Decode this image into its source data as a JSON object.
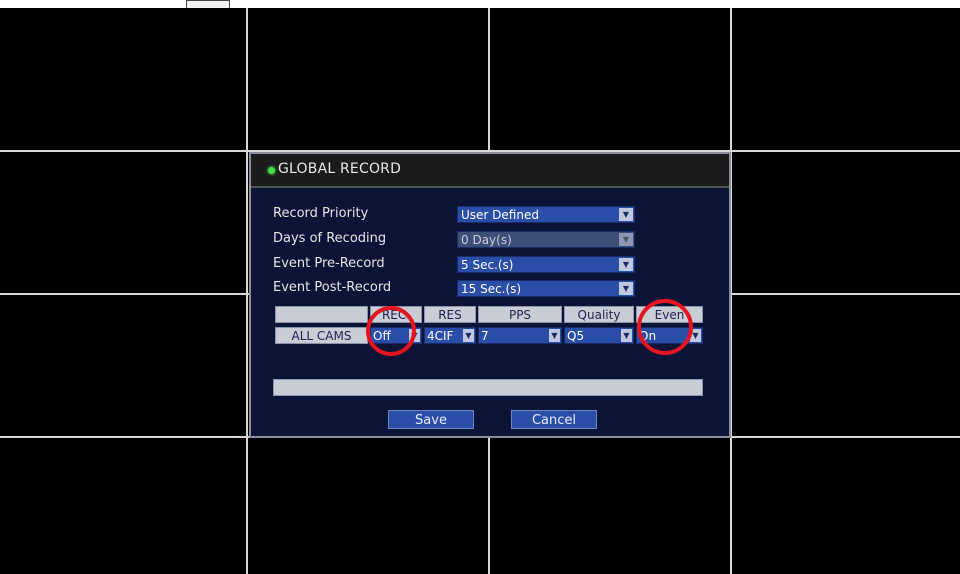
{
  "dialog": {
    "title": "GLOBAL RECORD",
    "status_color": "#3ee04a",
    "fields": [
      {
        "label": "Record Priority",
        "value": "User Defined",
        "disabled": false
      },
      {
        "label": "Days of Recoding",
        "value": "0 Day(s)",
        "disabled": true
      },
      {
        "label": "Event Pre-Record",
        "value": "5 Sec.(s)",
        "disabled": false
      },
      {
        "label": "Event Post-Record",
        "value": "15 Sec.(s)",
        "disabled": false
      }
    ],
    "table": {
      "headers": [
        "REC.",
        "RES",
        "PPS",
        "Quality",
        "Even"
      ],
      "row_label": "ALL CAMS",
      "values": [
        "Off",
        "4CIF",
        "7",
        "Q5",
        "On"
      ]
    },
    "buttons": {
      "save": "Save",
      "cancel": "Cancel"
    }
  },
  "annotations": {
    "highlight_color": "#e5141e",
    "highlighted": [
      "REC.",
      "Even"
    ]
  }
}
